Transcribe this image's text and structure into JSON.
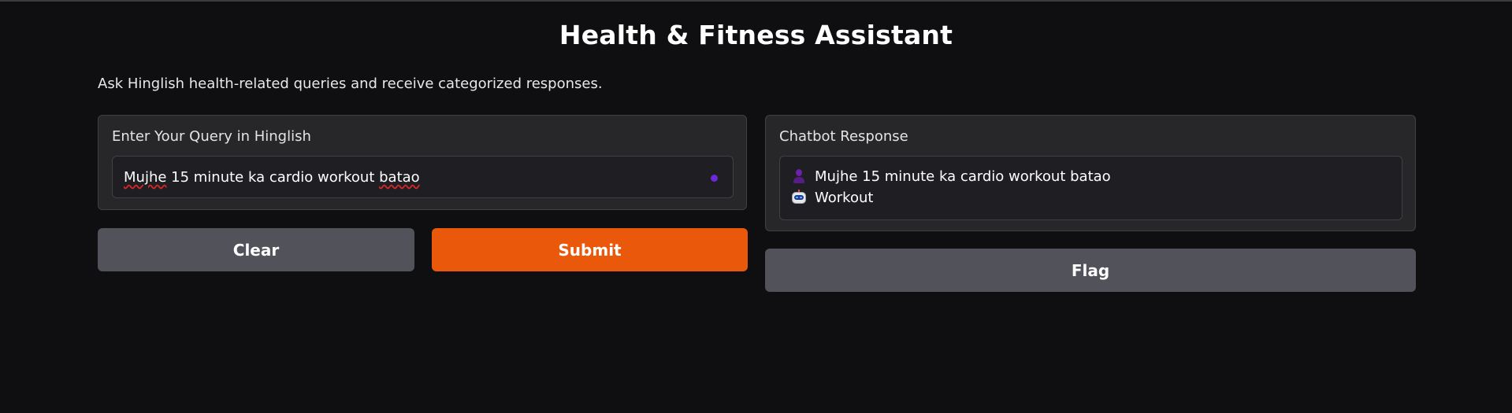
{
  "header": {
    "title": "Health & Fitness Assistant",
    "description": "Ask Hinglish health-related queries and receive categorized responses."
  },
  "query_panel": {
    "label": "Enter Your Query in Hinglish",
    "input_value_parts": [
      "Mujhe",
      " 15 minute ka cardio workout ",
      "batao"
    ],
    "status_color": "#6d28d9"
  },
  "response_panel": {
    "label": "Chatbot Response",
    "messages": [
      {
        "role": "user",
        "avatar_icon": "user-avatar-icon",
        "text": "Mujhe 15 minute ka cardio workout batao"
      },
      {
        "role": "bot",
        "avatar_icon": "robot-avatar-icon",
        "text": "Workout"
      }
    ]
  },
  "buttons": {
    "clear_label": "Clear",
    "submit_label": "Submit",
    "flag_label": "Flag"
  },
  "colors": {
    "accent": "#ea580c",
    "secondary_button": "#52525b",
    "background": "#0f0f11",
    "panel": "#27272a"
  }
}
